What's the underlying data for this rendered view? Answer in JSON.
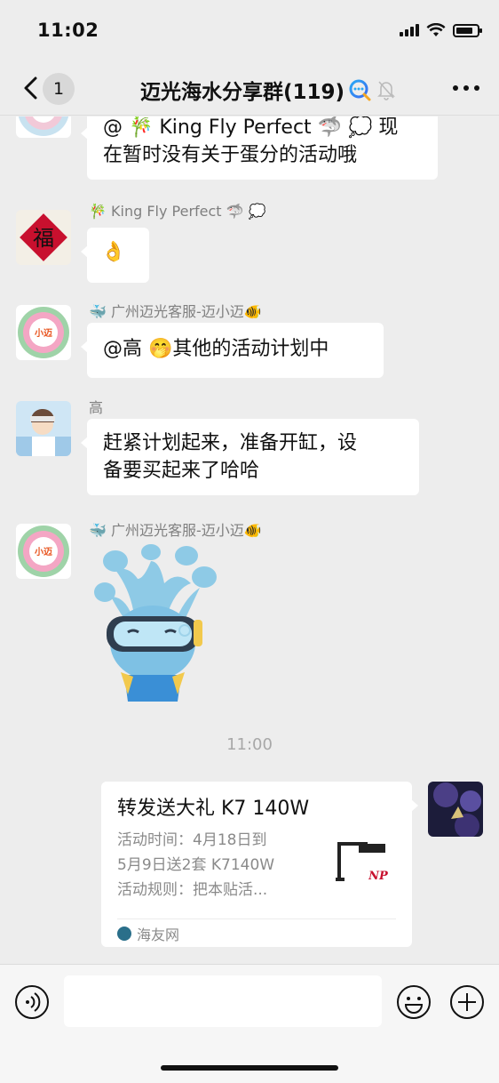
{
  "status_bar": {
    "time": "11:02",
    "battery_level": 0.8
  },
  "nav": {
    "unread_count": "1",
    "title": "迈光海水分享群(119)"
  },
  "messages": [
    {
      "text_line1": "@ 🎋 King Fly Perfect 🦈 💭 现",
      "text_line2": "在暂时没有关于蛋分的活动哦"
    },
    {
      "sender": "🎋 King Fly Perfect 🦈 💭",
      "text": "👌",
      "avatar_char": "福"
    },
    {
      "sender": "🐳 广州迈光客服-迈小迈🐠",
      "text": "@高 🤭其他的活动计划中",
      "avatar_char": "小迈"
    },
    {
      "sender": "高",
      "text_line1": "赶紧计划起来，准备开缸，设",
      "text_line2": "备要买起来了哈哈"
    },
    {
      "sender": "🐳 广州迈光客服-迈小迈🐠",
      "sticker": "blue-splash-diver-sticker",
      "avatar_char": "小迈"
    }
  ],
  "timestamp": "11:00",
  "link_card": {
    "title": "转发送大礼 K7 140W",
    "desc_line1": "活动时间：4月18日到",
    "desc_line2": "5月9日送2套 K7140W",
    "desc_line3": "活动规则：把本贴活...",
    "source": "海友网",
    "thumb_text": "NP"
  },
  "input_bar": {
    "placeholder": ""
  },
  "colors": {
    "background": "#ededed",
    "bubble": "#ffffff",
    "meta_text": "#7f7f7f"
  }
}
